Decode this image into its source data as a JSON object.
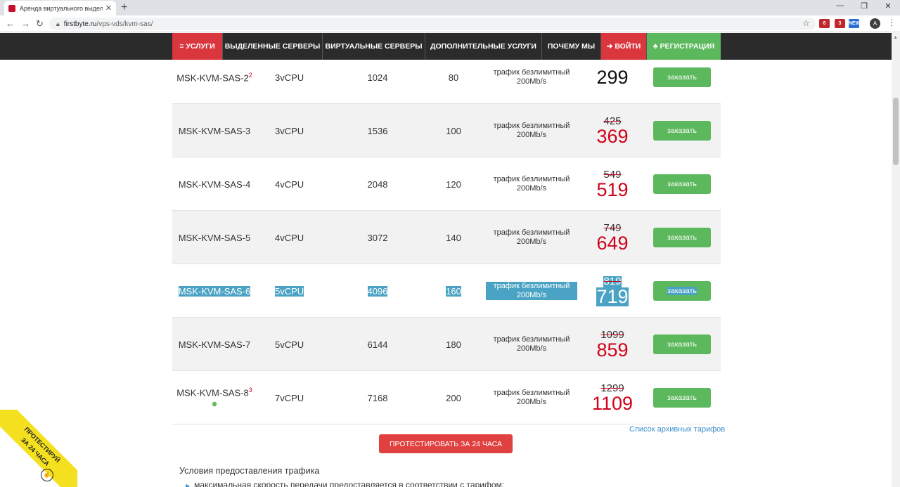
{
  "browser": {
    "tab_title": "Аренда виртуального выделен",
    "tab_close": "✕",
    "new_tab": "+",
    "url_host": "firstbyte.ru",
    "url_path": "/vps-vds/kvm-sas/",
    "avatar_letter": "A",
    "ext_badges": [
      "6",
      "3",
      "NEW"
    ]
  },
  "nav": {
    "items": [
      {
        "label": "≡ УСЛУГИ",
        "color": "#d9363e"
      },
      {
        "label": "ВЫДЕЛЕННЫЕ СЕРВЕРЫ",
        "color": "#2b2b2b"
      },
      {
        "label": "ВИРТУАЛЬНЫЕ СЕРВЕРЫ",
        "color": "#2b2b2b"
      },
      {
        "label": "ДОПОЛНИТЕЛЬНЫЕ УСЛУГИ",
        "color": "#2b2b2b"
      },
      {
        "label": "ПОЧЕМУ МЫ",
        "color": "#2b2b2b"
      },
      {
        "label": "➜ ВОЙТИ",
        "color": "#d9363e"
      },
      {
        "label": "♣ РЕГИСТРАЦИЯ",
        "color": "#5cb85c"
      }
    ]
  },
  "rows": [
    {
      "name": "MSK-KVM-SAS-2",
      "sup": "2",
      "cpu": "3vCPU",
      "ram": "1024",
      "disk": "80",
      "traffic": "трафик безлимитный 200Mb/s",
      "old_price": "",
      "price": "299",
      "button": "заказать"
    },
    {
      "name": "MSK-KVM-SAS-3",
      "sup": "",
      "cpu": "3vCPU",
      "ram": "1536",
      "disk": "100",
      "traffic": "трафик безлимитный 200Mb/s",
      "old_price": "425",
      "price": "369",
      "button": "заказать"
    },
    {
      "name": "MSK-KVM-SAS-4",
      "sup": "",
      "cpu": "4vCPU",
      "ram": "2048",
      "disk": "120",
      "traffic": "трафик безлимитный 200Mb/s",
      "old_price": "549",
      "price": "519",
      "button": "заказать"
    },
    {
      "name": "MSK-KVM-SAS-5",
      "sup": "",
      "cpu": "4vCPU",
      "ram": "3072",
      "disk": "140",
      "traffic": "трафик безлимитный 200Mb/s",
      "old_price": "749",
      "price": "649",
      "button": "заказать"
    },
    {
      "name": "MSK-KVM-SAS-6",
      "sup": "",
      "cpu": "5vCPU",
      "ram": "4096",
      "disk": "160",
      "traffic": "трафик безлимитный 200Mb/s",
      "old_price": "819",
      "price": "719",
      "button": "заказать"
    },
    {
      "name": "MSK-KVM-SAS-7",
      "sup": "",
      "cpu": "5vCPU",
      "ram": "6144",
      "disk": "180",
      "traffic": "трафик безлимитный 200Mb/s",
      "old_price": "1099",
      "price": "859",
      "button": "заказать"
    },
    {
      "name": "MSK-KVM-SAS-8",
      "sup": "3",
      "cpu": "7vCPU",
      "ram": "7168",
      "disk": "200",
      "traffic": "трафик безлимитный 200Mb/s",
      "old_price": "1299",
      "price": "1109",
      "button": "заказать"
    }
  ],
  "archive_link": "Список архивных тарифов",
  "test_button": "ПРОТЕСТИРОВАТЬ ЗА 24 ЧАСА",
  "conditions": {
    "title": "Условия предоставления трафика",
    "item": "максимальная скорость передачи предоставляется в соответствии с тарифом:"
  },
  "ribbon": {
    "line1": "ПРОТЕСТИРУЙ",
    "line2": "ЗА 24 ЧАСА"
  }
}
